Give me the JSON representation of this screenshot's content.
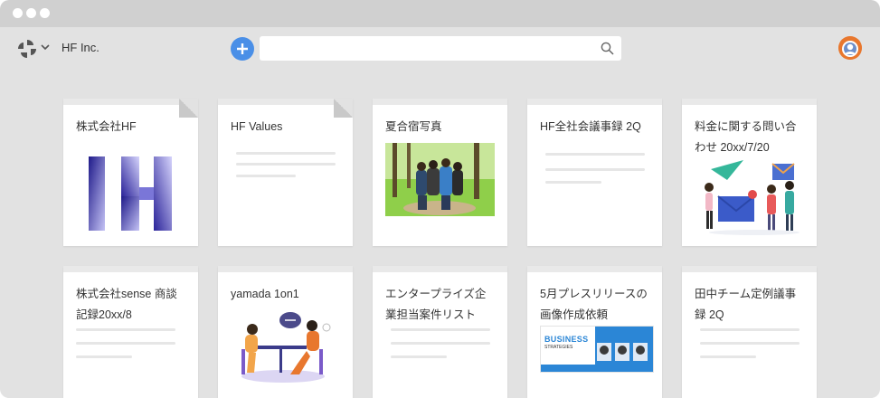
{
  "app": {
    "company": "HF Inc."
  },
  "search": {
    "placeholder": ""
  },
  "icons": {
    "logo": "logo-icon",
    "chevron": "chevron-down-icon",
    "add": "plus-icon",
    "search": "search-icon",
    "avatar": "avatar"
  },
  "colors": {
    "accent": "#4a8fe7",
    "background": "#e2e2e2",
    "card": "#ffffff"
  },
  "cards": [
    {
      "title": "株式会社HF",
      "thumbnail": "hf-logo-image"
    },
    {
      "title": "HF Values",
      "thumbnail": "text-lines"
    },
    {
      "title": "夏合宿写真",
      "thumbnail": "group-photo"
    },
    {
      "title": "HF全社会議事録 2Q",
      "thumbnail": "text-lines"
    },
    {
      "title": "料金に関する問い合わせ 20xx/7/20",
      "thumbnail": "mail-illustration"
    },
    {
      "title": "株式会社sense 商談記録20xx/8",
      "thumbnail": "text-lines"
    },
    {
      "title": "yamada 1on1",
      "thumbnail": "meeting-illustration"
    },
    {
      "title": "エンタープライズ企業担当案件リスト",
      "thumbnail": "text-lines"
    },
    {
      "title": "5月プレスリリースの画像作成依頼",
      "thumbnail": "business-banner"
    },
    {
      "title": "田中チーム定例議事録 2Q",
      "thumbnail": "text-lines"
    }
  ],
  "banner": {
    "headline": "BUSINESS",
    "subline": "STRATEGIES"
  }
}
